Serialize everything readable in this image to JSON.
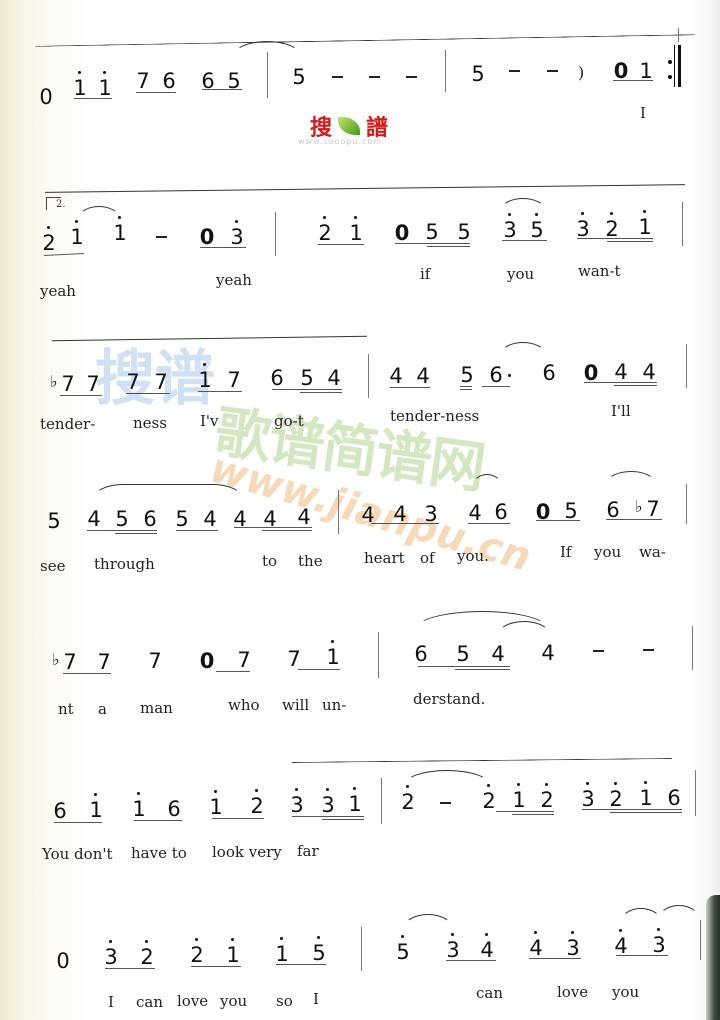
{
  "watermarks": {
    "logo_left": "搜",
    "logo_right": "譜",
    "logo_sub": "www.sooopu.com",
    "big_text": "歌谱简谱网",
    "big_blue": "搜谱",
    "url": "www.jianpu.cn"
  },
  "score": {
    "volta_label": "2.",
    "lines": [
      {
        "notes": [
          "0",
          "1̇",
          "1̇",
          "7",
          "6",
          "6",
          "5",
          "5",
          "-",
          "-",
          "-",
          "5",
          "-",
          "-",
          ")",
          "0",
          "1"
        ],
        "lyrics": [
          "I"
        ]
      },
      {
        "notes": [
          "2̇",
          "1̇",
          "1̇",
          "-",
          "0",
          "3̇",
          "2̇",
          "1̇",
          "0",
          "5",
          "5",
          "3̇",
          "5̇",
          "3̇",
          "2̇",
          "1̇"
        ],
        "lyrics": [
          "yeah",
          "yeah",
          "if",
          "you",
          "wan-t"
        ]
      },
      {
        "notes": [
          "♭7",
          "7",
          "7",
          "7",
          "1̇",
          "7",
          "6",
          "5",
          "4",
          "4",
          "4",
          "5",
          "6.",
          "6",
          "0",
          "4",
          "4"
        ],
        "lyrics": [
          "tender-",
          "ness",
          "I'v",
          "go-t",
          "tender-ness",
          "I'll"
        ]
      },
      {
        "notes": [
          "5",
          "4",
          "5",
          "6",
          "5",
          "4",
          "4",
          "4",
          "4",
          "4",
          "4",
          "3",
          "4",
          "6",
          "0",
          "5",
          "6",
          "♭7"
        ],
        "lyrics": [
          "see",
          "through",
          "to",
          "the",
          "heart",
          "of",
          "you.",
          "If",
          "you",
          "wa-"
        ]
      },
      {
        "notes": [
          "♭7",
          "7",
          "7",
          "0",
          "7",
          "7",
          "1̇",
          "6",
          "5",
          "4",
          "4",
          "-",
          "-"
        ],
        "lyrics": [
          "nt",
          "a",
          "man",
          "who",
          "will",
          "un-",
          "derstand."
        ]
      },
      {
        "notes": [
          "6",
          "1̇",
          "1̇",
          "6",
          "1̇",
          "2̇",
          "3̇",
          "3̇",
          "1̇",
          "2̇",
          "-",
          "2̇",
          "1̇",
          "2̇",
          "3̇",
          "2̇",
          "1̇",
          "6"
        ],
        "lyrics": [
          "You don't",
          "have to",
          "look very",
          "far"
        ]
      },
      {
        "notes": [
          "0",
          "3̇",
          "2̇",
          "2̇",
          "1̇",
          "1̇",
          "5̇",
          "5̇",
          "3̇",
          "4̇",
          "4̇",
          "3̇",
          "4̇",
          "3̇"
        ],
        "lyrics": [
          "I",
          "can",
          "love",
          "you",
          "so",
          "I",
          "can",
          "love",
          "you"
        ]
      }
    ]
  },
  "labels": {
    "n0": "0",
    "n1": "1",
    "n2": "2",
    "n3": "3",
    "n4": "4",
    "n5": "5",
    "n6": "6",
    "n7": "7",
    "flat": "♭"
  }
}
